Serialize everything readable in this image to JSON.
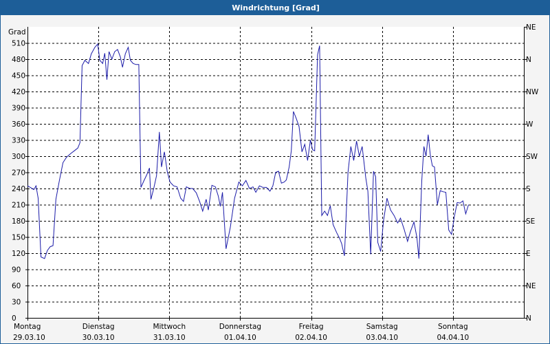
{
  "window": {
    "title": "Windrichtung [Grad]"
  },
  "colors": {
    "titlebar": "#1d5e98",
    "line": "#1a1aa8",
    "plot_bg": "#ffffff",
    "frame_bg": "#f4f4f4",
    "grid": "#000000"
  },
  "chart_data": {
    "type": "line",
    "title": "Windrichtung [Grad]",
    "ylabel": "Grad",
    "ylim": [
      0,
      540
    ],
    "yticks": [
      0,
      30,
      60,
      90,
      120,
      150,
      180,
      210,
      240,
      270,
      300,
      330,
      360,
      390,
      420,
      450,
      480,
      510
    ],
    "right_axis_labels": [
      {
        "value": 0,
        "label": "N"
      },
      {
        "value": 30,
        "label": "NE"
      },
      {
        "value": 60,
        "label": "E"
      },
      {
        "value": 90,
        "label": "SE"
      },
      {
        "value": 120,
        "label": "S"
      },
      {
        "value": 150,
        "label": "SW"
      },
      {
        "value": 180,
        "label": "W"
      },
      {
        "value": 210,
        "label": "NW"
      },
      {
        "value": 240,
        "label": "N"
      },
      {
        "value": 270,
        "label": "NE"
      },
      {
        "value": 300,
        "label": "E"
      },
      {
        "value": 330,
        "label": "SE"
      },
      {
        "value": 360,
        "label": "S"
      }
    ],
    "xlim": [
      0,
      7
    ],
    "x_unit": "days from Montag 29.03.10 00:00",
    "x_labels": [
      {
        "x": 0,
        "day": "Montag",
        "date": "29.03.10"
      },
      {
        "x": 1,
        "day": "Dienstag",
        "date": "30.03.10"
      },
      {
        "x": 2,
        "day": "Mittwoch",
        "date": "31.03.10"
      },
      {
        "x": 3,
        "day": "Donnerstag",
        "date": "01.04.10"
      },
      {
        "x": 4,
        "day": "Freitag",
        "date": "02.04.10"
      },
      {
        "x": 5,
        "day": "Samstag",
        "date": "03.04.10"
      },
      {
        "x": 6,
        "day": "Sonntag",
        "date": "04.04.10"
      }
    ],
    "grid": true,
    "series": [
      {
        "values": [
          [
            0.0,
            245
          ],
          [
            0.04,
            242
          ],
          [
            0.09,
            238
          ],
          [
            0.12,
            245
          ],
          [
            0.15,
            222
          ],
          [
            0.19,
            113
          ],
          [
            0.24,
            110
          ],
          [
            0.28,
            125
          ],
          [
            0.32,
            132
          ],
          [
            0.36,
            134
          ],
          [
            0.4,
            220
          ],
          [
            0.45,
            255
          ],
          [
            0.5,
            288
          ],
          [
            0.55,
            298
          ],
          [
            0.61,
            305
          ],
          [
            0.66,
            310
          ],
          [
            0.71,
            315
          ],
          [
            0.74,
            325
          ],
          [
            0.77,
            468
          ],
          [
            0.81,
            478
          ],
          [
            0.86,
            472
          ],
          [
            0.9,
            490
          ],
          [
            0.95,
            502
          ],
          [
            0.99,
            508
          ],
          [
            1.02,
            478
          ],
          [
            1.06,
            472
          ],
          [
            1.09,
            491
          ],
          [
            1.12,
            442
          ],
          [
            1.15,
            494
          ],
          [
            1.19,
            480
          ],
          [
            1.23,
            494
          ],
          [
            1.27,
            498
          ],
          [
            1.31,
            484
          ],
          [
            1.34,
            465
          ],
          [
            1.38,
            490
          ],
          [
            1.42,
            502
          ],
          [
            1.45,
            478
          ],
          [
            1.49,
            472
          ],
          [
            1.53,
            470
          ],
          [
            1.57,
            470
          ],
          [
            1.6,
            242
          ],
          [
            1.64,
            254
          ],
          [
            1.68,
            265
          ],
          [
            1.72,
            278
          ],
          [
            1.74,
            220
          ],
          [
            1.78,
            240
          ],
          [
            1.82,
            264
          ],
          [
            1.86,
            345
          ],
          [
            1.89,
            280
          ],
          [
            1.93,
            308
          ],
          [
            1.97,
            272
          ],
          [
            2.01,
            252
          ],
          [
            2.06,
            245
          ],
          [
            2.11,
            243
          ],
          [
            2.16,
            222
          ],
          [
            2.2,
            216
          ],
          [
            2.24,
            243
          ],
          [
            2.29,
            240
          ],
          [
            2.33,
            240
          ],
          [
            2.38,
            232
          ],
          [
            2.43,
            215
          ],
          [
            2.47,
            198
          ],
          [
            2.52,
            220
          ],
          [
            2.55,
            200
          ],
          [
            2.6,
            246
          ],
          [
            2.65,
            243
          ],
          [
            2.69,
            226
          ],
          [
            2.72,
            207
          ],
          [
            2.75,
            233
          ],
          [
            2.8,
            128
          ],
          [
            2.86,
            168
          ],
          [
            2.92,
            222
          ],
          [
            2.98,
            252
          ],
          [
            3.03,
            245
          ],
          [
            3.08,
            255
          ],
          [
            3.13,
            240
          ],
          [
            3.18,
            243
          ],
          [
            3.22,
            233
          ],
          [
            3.27,
            245
          ],
          [
            3.32,
            242
          ],
          [
            3.37,
            242
          ],
          [
            3.42,
            235
          ],
          [
            3.46,
            245
          ],
          [
            3.5,
            270
          ],
          [
            3.54,
            272
          ],
          [
            3.58,
            250
          ],
          [
            3.62,
            252
          ],
          [
            3.65,
            256
          ],
          [
            3.69,
            280
          ],
          [
            3.72,
            310
          ],
          [
            3.75,
            383
          ],
          [
            3.79,
            370
          ],
          [
            3.83,
            355
          ],
          [
            3.87,
            308
          ],
          [
            3.91,
            322
          ],
          [
            3.95,
            292
          ],
          [
            3.99,
            330
          ],
          [
            4.02,
            312
          ],
          [
            4.05,
            310
          ],
          [
            4.09,
            488
          ],
          [
            4.12,
            505
          ],
          [
            4.15,
            190
          ],
          [
            4.19,
            198
          ],
          [
            4.23,
            190
          ],
          [
            4.27,
            208
          ],
          [
            4.31,
            173
          ],
          [
            4.36,
            158
          ],
          [
            4.4,
            148
          ],
          [
            4.43,
            138
          ],
          [
            4.47,
            115
          ],
          [
            4.52,
            270
          ],
          [
            4.56,
            318
          ],
          [
            4.6,
            292
          ],
          [
            4.64,
            328
          ],
          [
            4.68,
            300
          ],
          [
            4.72,
            318
          ],
          [
            4.77,
            260
          ],
          [
            4.8,
            235
          ],
          [
            4.84,
            118
          ],
          [
            4.88,
            272
          ],
          [
            4.91,
            262
          ],
          [
            4.94,
            140
          ],
          [
            4.98,
            123
          ],
          [
            5.02,
            180
          ],
          [
            5.07,
            222
          ],
          [
            5.12,
            200
          ],
          [
            5.17,
            190
          ],
          [
            5.22,
            176
          ],
          [
            5.26,
            185
          ],
          [
            5.31,
            165
          ],
          [
            5.36,
            142
          ],
          [
            5.4,
            160
          ],
          [
            5.45,
            178
          ],
          [
            5.49,
            150
          ],
          [
            5.52,
            110
          ],
          [
            5.56,
            255
          ],
          [
            5.59,
            318
          ],
          [
            5.62,
            300
          ],
          [
            5.65,
            340
          ],
          [
            5.68,
            302
          ],
          [
            5.71,
            282
          ],
          [
            5.74,
            280
          ],
          [
            5.78,
            210
          ],
          [
            5.82,
            236
          ],
          [
            5.86,
            234
          ],
          [
            5.9,
            233
          ],
          [
            5.94,
            163
          ],
          [
            5.98,
            155
          ],
          [
            6.02,
            188
          ],
          [
            6.06,
            214
          ],
          [
            6.1,
            213
          ],
          [
            6.14,
            217
          ],
          [
            6.18,
            193
          ],
          [
            6.22,
            210
          ]
        ]
      }
    ]
  }
}
